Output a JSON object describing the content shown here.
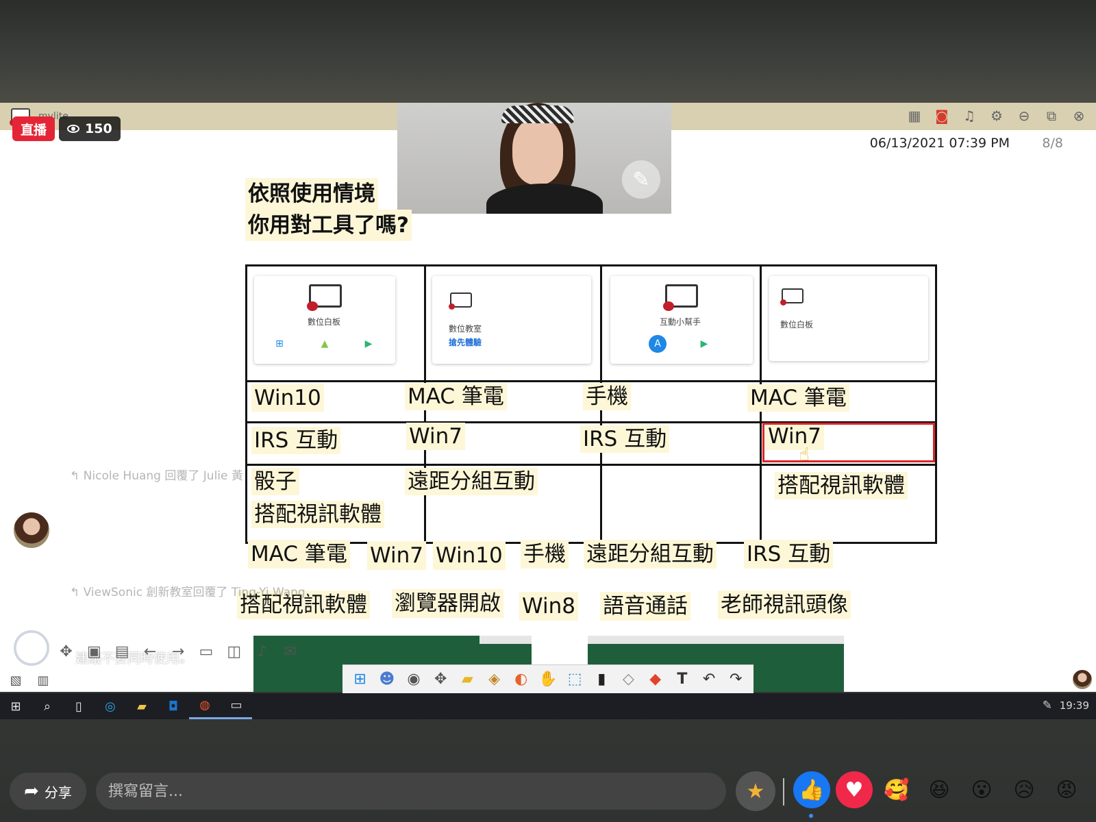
{
  "stream": {
    "live_label": "直播",
    "viewer_count": "150"
  },
  "app": {
    "name": "mylite",
    "datetime": "06/13/2021 07:39 PM",
    "page": "8/8"
  },
  "slide": {
    "title_line1": "依照使用情境",
    "title_line2": "你用對工具了嗎?",
    "cards": [
      {
        "label": "數位白板"
      },
      {
        "label": "數位教室",
        "sub": "搶先體驗"
      },
      {
        "label": "互動小幫手"
      },
      {
        "label": "數位白板"
      }
    ],
    "rows": [
      [
        "Win10",
        "MAC 筆電",
        "手機",
        "MAC 筆電"
      ],
      [
        "IRS 互動",
        "Win7",
        "IRS 互動",
        "Win7"
      ],
      [
        "骰子",
        "遠距分組互動",
        "",
        "搭配視訊軟體"
      ]
    ],
    "extra_cell": "搭配視訊軟體",
    "options_row1": [
      "MAC 筆電",
      "Win7",
      "Win10",
      "手機",
      "遠距分組互動",
      "IRS 互動"
    ],
    "options_row2": [
      "搭配視訊軟體",
      "瀏覽器開啟",
      "Win8",
      "語音通話",
      "老師視訊頭像"
    ]
  },
  "comments": {
    "ghost1": "Nicole Huang 回覆了 Julie 黃",
    "ghost2": "ViewSonic 創新教室回覆了 Ting-Yi Wang",
    "ghost3": "ViewSonic 創新教室",
    "overlay_text": "建議不要同時使用。"
  },
  "taskbar": {
    "time": "19:39"
  },
  "footer": {
    "share_label": "分享",
    "comment_placeholder": "撰寫留言..."
  },
  "colors": {
    "live_red": "#e42535",
    "highlight_yellow": "#fdf7d8",
    "cell_highlight_red": "#d9252a",
    "titlebar": "#d9d0b1"
  }
}
